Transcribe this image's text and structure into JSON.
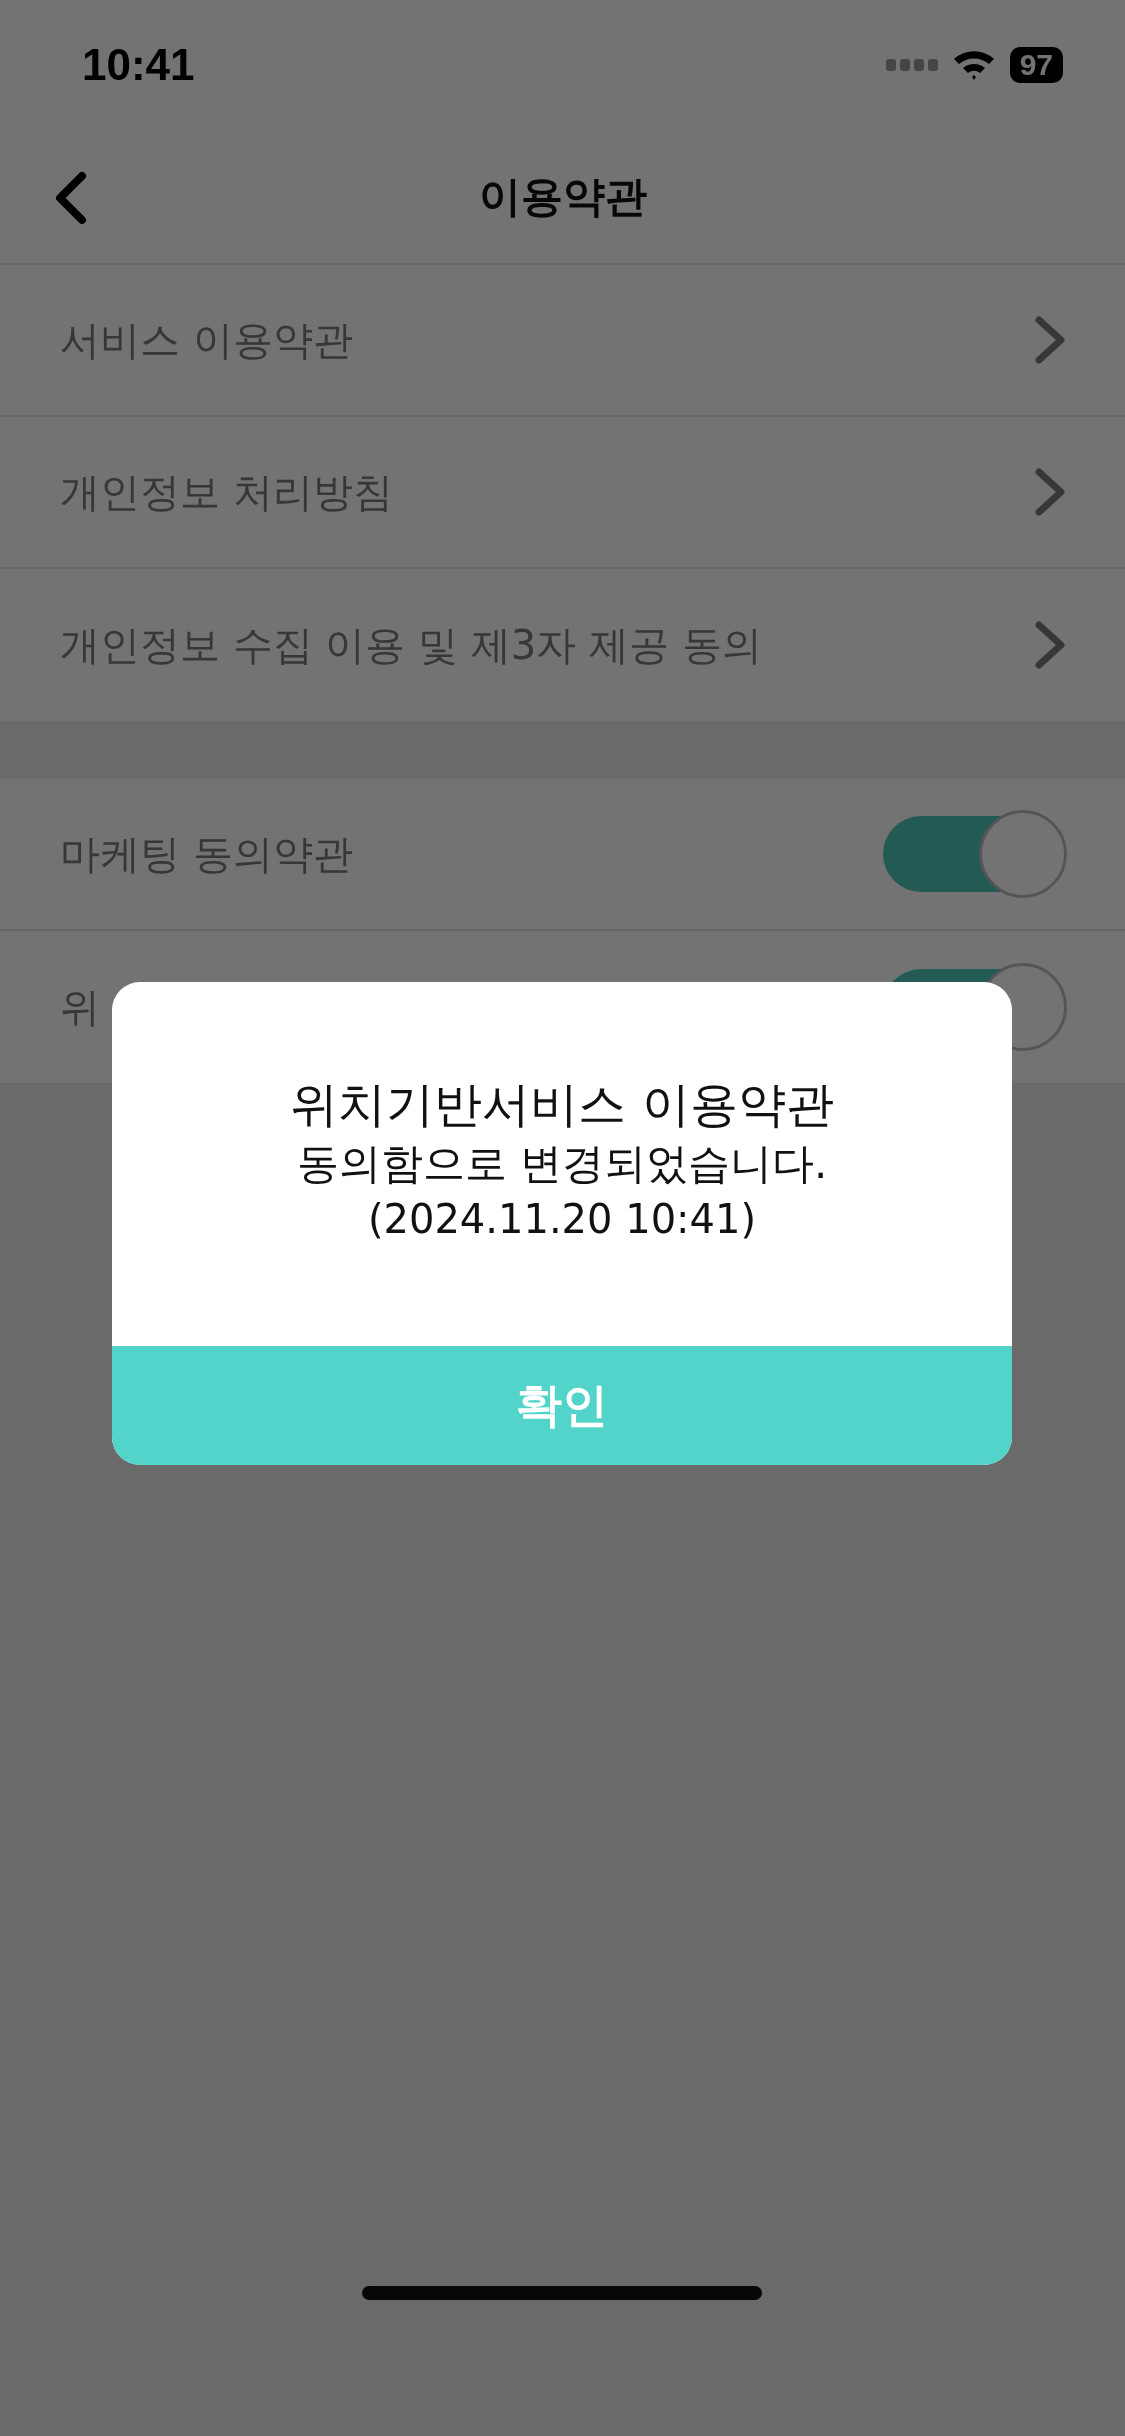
{
  "status_bar": {
    "time": "10:41",
    "battery": "97"
  },
  "nav": {
    "title": "이용약관"
  },
  "sections": [
    {
      "items": [
        {
          "kind": "link",
          "label": "서비스 이용약관"
        },
        {
          "kind": "link",
          "label": "개인정보 처리방침"
        },
        {
          "kind": "link",
          "label": "개인정보 수집 이용 및 제3자 제공 동의"
        }
      ]
    },
    {
      "items": [
        {
          "kind": "toggle",
          "label": "마케팅 동의약관",
          "on": true
        },
        {
          "kind": "toggle",
          "label": "위",
          "on": true
        }
      ]
    }
  ],
  "dialog": {
    "lines": [
      "위치기반서비스 이용약관",
      "동의함으로 변경되었습니다.",
      "(2024.11.20 10:41)"
    ],
    "button": "확인"
  }
}
